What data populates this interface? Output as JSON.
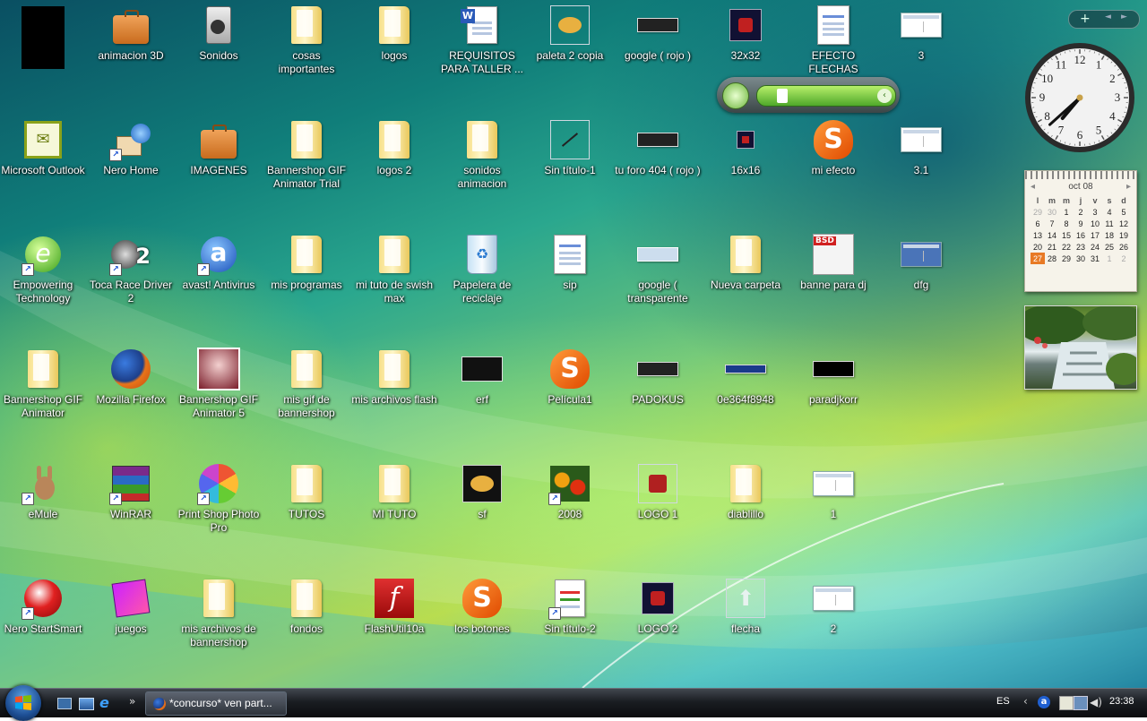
{
  "desktop_icons": {
    "c0": [
      {
        "label": "",
        "kind": "black"
      },
      {
        "label": "Microsoft Outlook",
        "kind": "outlook"
      },
      {
        "label": "Empowering Technology",
        "kind": "e-app"
      },
      {
        "label": "Bannershop GIF Animator",
        "kind": "folder"
      },
      {
        "label": "eMule",
        "kind": "emule"
      },
      {
        "label": "Nero StartSmart",
        "kind": "nero"
      }
    ],
    "c1": [
      {
        "label": "animacion 3D",
        "kind": "briefcase"
      },
      {
        "label": "Nero Home",
        "kind": "nerohome"
      },
      {
        "label": "Toca Race Driver 2",
        "kind": "toca"
      },
      {
        "label": "Mozilla Firefox",
        "kind": "firefox"
      },
      {
        "label": "WinRAR",
        "kind": "winrar"
      },
      {
        "label": "juegos",
        "kind": "juegos"
      }
    ],
    "c2": [
      {
        "label": "Sonidos",
        "kind": "speaker"
      },
      {
        "label": "IMAGENES",
        "kind": "briefcase"
      },
      {
        "label": "avast! Antivirus",
        "kind": "avast"
      },
      {
        "label": "Bannershop GIF Animator 5",
        "kind": "photo-red"
      },
      {
        "label": "Print Shop Photo Pro",
        "kind": "printshop"
      },
      {
        "label": "mis archivos de bannershop",
        "kind": "folder"
      }
    ],
    "c3": [
      {
        "label": "cosas importantes",
        "kind": "folder"
      },
      {
        "label": "Bannershop GIF Animator Trial",
        "kind": "folder"
      },
      {
        "label": "mis programas",
        "kind": "folder"
      },
      {
        "label": "mis gif de bannershop",
        "kind": "folder"
      },
      {
        "label": "TUTOS",
        "kind": "folder"
      },
      {
        "label": "fondos",
        "kind": "folder"
      }
    ],
    "c4": [
      {
        "label": "logos",
        "kind": "folder"
      },
      {
        "label": "logos 2",
        "kind": "folder"
      },
      {
        "label": "mi tuto de swish max",
        "kind": "folder"
      },
      {
        "label": "mis archivos flash",
        "kind": "folder"
      },
      {
        "label": "MI TUTO",
        "kind": "folder"
      },
      {
        "label": "FlashUtil10a",
        "kind": "flash"
      }
    ],
    "c5": [
      {
        "label": "REQUISITOS PARA TALLER ...",
        "kind": "word"
      },
      {
        "label": "sonidos animacion",
        "kind": "folder"
      },
      {
        "label": "Papelera de reciclaje",
        "kind": "recycle"
      },
      {
        "label": "erf",
        "kind": "dark"
      },
      {
        "label": "sf",
        "kind": "paint"
      },
      {
        "label": "los botones",
        "kind": "swish"
      }
    ],
    "c6": [
      {
        "label": "paleta 2 copia",
        "kind": "paint-square"
      },
      {
        "label": "Sin título-1",
        "kind": "square-line"
      },
      {
        "label": "sip",
        "kind": "calc-doc"
      },
      {
        "label": "Película1",
        "kind": "swish"
      },
      {
        "label": "2008",
        "kind": "flowers"
      },
      {
        "label": "Sin título-2",
        "kind": "doc-shortcut"
      }
    ],
    "c7": [
      {
        "label": "google ( rojo )",
        "kind": "strip"
      },
      {
        "label": "tu foro 404 ( rojo )",
        "kind": "strip"
      },
      {
        "label": "google ( transparente",
        "kind": "google"
      },
      {
        "label": "PADOKUS",
        "kind": "strip"
      },
      {
        "label": "LOGO 1",
        "kind": "logo-square"
      },
      {
        "label": "LOGO 2",
        "kind": "logo-small"
      }
    ],
    "c8": [
      {
        "label": "32x32",
        "kind": "logo-small"
      },
      {
        "label": "16x16",
        "kind": "logo-tiny"
      },
      {
        "label": "Nueva carpeta",
        "kind": "folder"
      },
      {
        "label": "0e364f8948",
        "kind": "strip-blue"
      },
      {
        "label": "diablillo",
        "kind": "folder"
      },
      {
        "label": "flecha",
        "kind": "arrow"
      }
    ],
    "c9": [
      {
        "label": "EFECTO FLECHAS",
        "kind": "calc-doc"
      },
      {
        "label": "mi efecto",
        "kind": "swish"
      },
      {
        "label": "banne para dj",
        "kind": "bsd"
      },
      {
        "label": "paradjkorr",
        "kind": "black-strip"
      },
      {
        "label": "1",
        "kind": "thumb"
      },
      {
        "label": "2",
        "kind": "thumb"
      }
    ],
    "c10": [
      {
        "label": "3",
        "kind": "thumb"
      },
      {
        "label": "3.1",
        "kind": "thumb"
      },
      {
        "label": "dfg",
        "kind": "blue-thumb"
      }
    ]
  },
  "sidebar": {
    "controls": {
      "add": "+",
      "prev": "◄",
      "next": "►"
    },
    "clock": {
      "numbers": [
        "12",
        "1",
        "2",
        "3",
        "4",
        "5",
        "6",
        "7",
        "8",
        "9",
        "10",
        "11"
      ],
      "hour_angle": 220,
      "minute_angle": 228
    },
    "calendar": {
      "month": "oct 08",
      "days_header": [
        "l",
        "m",
        "m",
        "j",
        "v",
        "s",
        "d"
      ],
      "weeks": [
        [
          "29",
          "30",
          "1",
          "2",
          "3",
          "4",
          "5"
        ],
        [
          "6",
          "7",
          "8",
          "9",
          "10",
          "11",
          "12"
        ],
        [
          "13",
          "14",
          "15",
          "16",
          "17",
          "18",
          "19"
        ],
        [
          "20",
          "21",
          "22",
          "23",
          "24",
          "25",
          "26"
        ],
        [
          "27",
          "28",
          "29",
          "30",
          "31",
          "1",
          "2"
        ]
      ],
      "today": "27"
    }
  },
  "taskbar": {
    "active_window": "*concurso* ven part...",
    "language": "ES",
    "time": "23:38",
    "expand": "»"
  },
  "colors": {
    "accent": "#1d4e94",
    "calendar_today": "#e87a25"
  }
}
